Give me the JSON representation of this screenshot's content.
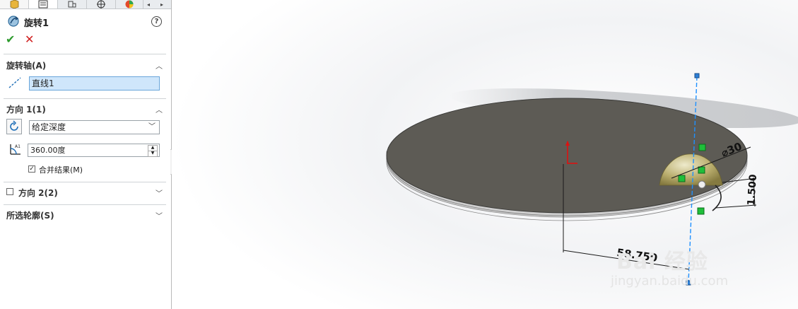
{
  "feature": {
    "title": "旋转1",
    "help_label": "?",
    "ok_label": "✔",
    "cancel_label": "✕"
  },
  "sections": {
    "axis": {
      "label": "旋转轴(A)",
      "value": "直线1"
    },
    "direction1": {
      "label": "方向 1(1)",
      "end_condition": "给定深度",
      "angle": "360.00度",
      "merge_label": "合并结果(M)",
      "merge_checked": "✓"
    },
    "direction2": {
      "label": "方向 2(2)"
    },
    "contours": {
      "label": "所选轮廓(S)"
    }
  },
  "viewport": {
    "dim_diameter": "⌀30",
    "dim_thickness": "1.500",
    "dim_distance": "58.750",
    "watermark": "Bai 经验",
    "watermark_url": "jingyan.baidu.com"
  },
  "colors": {
    "accent": "#2e9b2e",
    "cancel": "#d02020",
    "axis_blue": "#1e90ff",
    "disc_top": "#5d5b55",
    "disc_edge": "#cfcfcf"
  }
}
